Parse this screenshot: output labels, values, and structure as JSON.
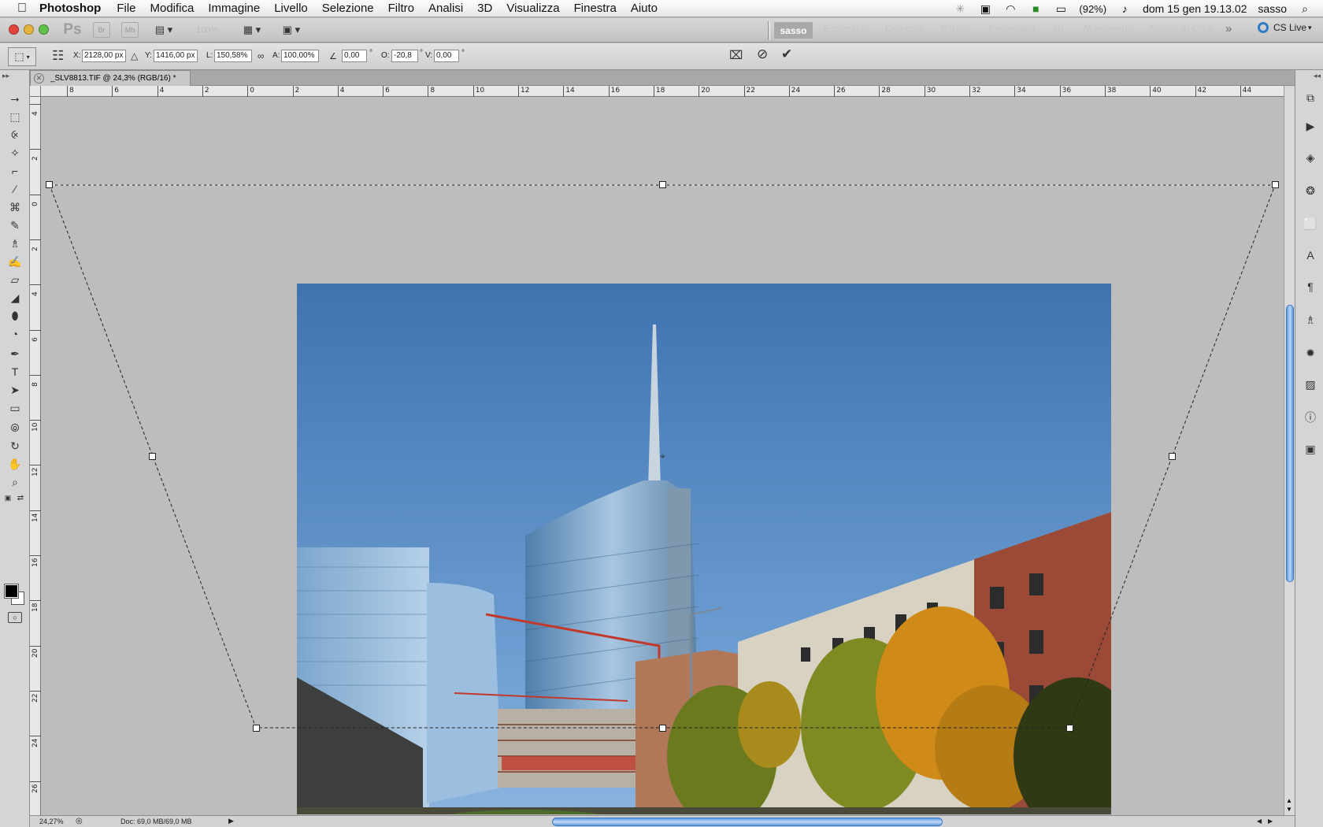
{
  "menubar": {
    "app_name": "Photoshop",
    "items": [
      "File",
      "Modifica",
      "Immagine",
      "Livello",
      "Selezione",
      "Filtro",
      "Analisi",
      "3D",
      "Visualizza",
      "Finestra",
      "Aiuto"
    ],
    "battery": "(92%)",
    "clock": "dom 15 gen  19.13.02",
    "user": "sasso"
  },
  "appbar": {
    "ps_logo": "Ps",
    "br": "Br",
    "mb": "Mb",
    "zoom": "100%",
    "active_workspace": "sasso",
    "workspaces": [
      "Essenziali",
      "Disegno",
      "Pittura",
      "Fotografia",
      "3D",
      "Movimento",
      "Novità in CS 5"
    ],
    "more": "»",
    "cs_live": "CS Live"
  },
  "options": {
    "x_label": "X:",
    "x_value": "2128,00 px",
    "y_label": "Y:",
    "y_value": "1416,00 px",
    "w_label": "L:",
    "w_value": "150,58%",
    "h_label": "A:",
    "h_value": "100,00%",
    "angle_value": "0,00",
    "deg": "°",
    "hskew_label": "O:",
    "hskew_value": "-20,8",
    "vskew_label": "V:",
    "vskew_value": "0,00"
  },
  "document": {
    "tab_title": "_SLV8813.TIF @ 24,3% (RGB/16) *"
  },
  "rulers": {
    "top": [
      "8",
      "6",
      "4",
      "2",
      "0",
      "2",
      "4",
      "6",
      "8",
      "10",
      "12",
      "14",
      "16",
      "18",
      "20",
      "22",
      "24",
      "26",
      "28",
      "30",
      "32",
      "34",
      "36",
      "38",
      "40",
      "42",
      "44"
    ],
    "left": [
      "4",
      "2",
      "0",
      "2",
      "4",
      "6",
      "8",
      "10",
      "12",
      "14",
      "16",
      "18",
      "20",
      "22",
      "24",
      "26"
    ]
  },
  "status": {
    "zoom": "24,27%",
    "doc": "Doc: 69,0 MB/69,0 MB"
  }
}
